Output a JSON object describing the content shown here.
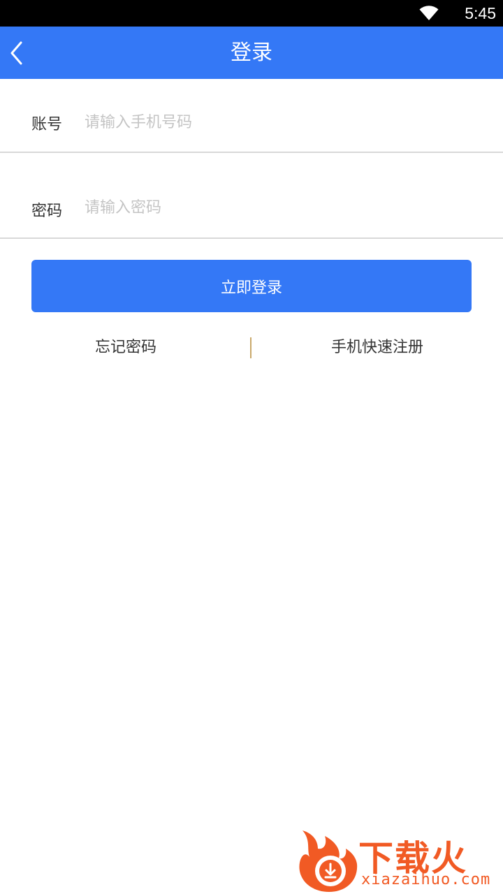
{
  "status_bar": {
    "time": "5:45"
  },
  "header": {
    "title": "登录"
  },
  "form": {
    "account": {
      "label": "账号",
      "placeholder": "请输入手机号码",
      "value": ""
    },
    "password": {
      "label": "密码",
      "placeholder": "请输入密码",
      "value": ""
    },
    "login_label": "立即登录"
  },
  "links": {
    "forgot": "忘记密码",
    "register": "手机快速注册"
  },
  "watermark": {
    "cn": "下载火",
    "en": "xiazaihuo.com"
  },
  "colors": {
    "primary": "#3478f6",
    "divider": "#c9a86a",
    "brand": "#f15a24"
  }
}
